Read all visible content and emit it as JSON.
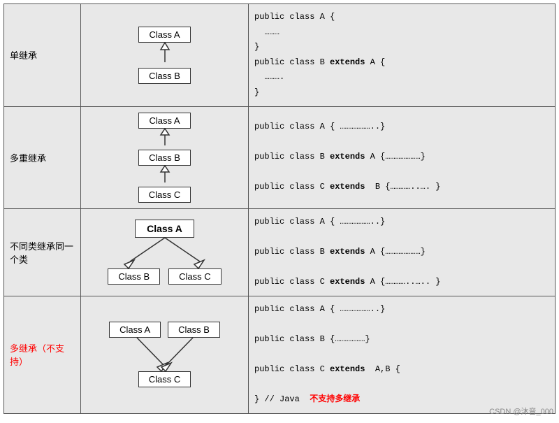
{
  "rows": [
    {
      "label": "单继承",
      "label_red": false,
      "code_lines": [
        {
          "text": "public class A {",
          "parts": [
            {
              "t": "public class A {",
              "b": false
            }
          ]
        },
        {
          "text": "  ………",
          "parts": [
            {
              "t": "  ………",
              "b": false
            }
          ]
        },
        {
          "text": "}",
          "parts": [
            {
              "t": "}",
              "b": false
            }
          ]
        },
        {
          "text": "public class B extends A {",
          "parts": [
            {
              "t": "public class B ",
              "b": false
            },
            {
              "t": "extends",
              "b": true
            },
            {
              "t": " A {",
              "b": false
            }
          ]
        },
        {
          "text": "  ……….",
          "parts": [
            {
              "t": "  ……….",
              "b": false
            }
          ]
        },
        {
          "text": "}",
          "parts": [
            {
              "t": "}",
              "b": false
            }
          ]
        }
      ]
    },
    {
      "label": "多重继承",
      "label_red": false,
      "code_lines": [
        {
          "text": "public class A { ………………..}",
          "parts": [
            {
              "t": "public class A { ………………..}",
              "b": false
            }
          ]
        },
        {
          "text": "",
          "parts": []
        },
        {
          "text": "public class B extends A {………………}",
          "parts": [
            {
              "t": "public class B ",
              "b": false
            },
            {
              "t": "extends",
              "b": true
            },
            {
              "t": " A {………………}",
              "b": false
            }
          ]
        },
        {
          "text": "",
          "parts": []
        },
        {
          "text": "public class C extends  B {…………..… }",
          "parts": [
            {
              "t": "public class C ",
              "b": false
            },
            {
              "t": "extends",
              "b": true
            },
            {
              "t": "  B {…………..… }",
              "b": false
            }
          ]
        }
      ]
    },
    {
      "label": "不同类继承同一个类",
      "label_red": false,
      "code_lines": [
        {
          "text": "public class A { ………………..}",
          "parts": [
            {
              "t": "public class A { ………………..}",
              "b": false
            }
          ]
        },
        {
          "text": "",
          "parts": []
        },
        {
          "text": "public class B extends A {………………}",
          "parts": [
            {
              "t": "public class B ",
              "b": false
            },
            {
              "t": "extends",
              "b": true
            },
            {
              "t": " A {………………}",
              "b": false
            }
          ]
        },
        {
          "text": "",
          "parts": []
        },
        {
          "text": "public class C extends A {…………..…. }",
          "parts": [
            {
              "t": "public class C ",
              "b": false
            },
            {
              "t": "extends",
              "b": true
            },
            {
              "t": " A {…………..…. }",
              "b": false
            }
          ]
        }
      ]
    },
    {
      "label": "多继承（不支持）",
      "label_red": true,
      "code_lines": [
        {
          "text": "public class A { ………………..}",
          "parts": [
            {
              "t": "public class A { ………………..}",
              "b": false
            }
          ]
        },
        {
          "text": "",
          "parts": []
        },
        {
          "text": "public class B {………………}",
          "parts": [
            {
              "t": "public class B {………………}",
              "b": false
            }
          ]
        },
        {
          "text": "",
          "parts": []
        },
        {
          "text": "public class C extends  A,B {",
          "parts": [
            {
              "t": "public class C ",
              "b": false
            },
            {
              "t": "extends",
              "b": true
            },
            {
              "t": "  A,B {",
              "b": false
            }
          ]
        },
        {
          "text": "",
          "parts": []
        },
        {
          "text": "} // Java  不支持多继承",
          "parts": [
            {
              "t": "} // Java  ",
              "b": false
            },
            {
              "t": "不支持多继承",
              "b": false,
              "red": true
            }
          ]
        }
      ]
    }
  ],
  "watermark": "CSDN @沐音_000"
}
